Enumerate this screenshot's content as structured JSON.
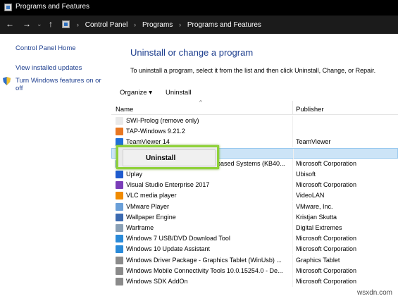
{
  "window": {
    "title": "Programs and Features"
  },
  "address": {
    "back_icon": "←",
    "forward_icon": "→",
    "recent_icon": "⌄",
    "up_icon": "↑",
    "crumbs": [
      "Control Panel",
      "Programs",
      "Programs and Features"
    ],
    "separator": "›"
  },
  "sidebar": {
    "home": "Control Panel Home",
    "updates": "View installed updates",
    "features_line1": "Turn Windows features on or",
    "features_line2": "off"
  },
  "main": {
    "heading": "Uninstall or change a program",
    "description": "To uninstall a program, select it from the list and then click Uninstall, Change, or Repair."
  },
  "toolbar": {
    "organize": "Organize",
    "organize_arrow": "▾",
    "uninstall": "Uninstall"
  },
  "columns": {
    "name": "Name",
    "publisher": "Publisher",
    "sort_arrow": "^"
  },
  "programs": [
    {
      "name": "SWI-Prolog (remove only)",
      "publisher": "",
      "icon": "prolog-icon",
      "color": "#e9e9e9"
    },
    {
      "name": "TAP-Windows 9.21.2",
      "publisher": "",
      "icon": "tap-icon",
      "color": "#e87722"
    },
    {
      "name": "TeamViewer 14",
      "publisher": "TeamViewer",
      "icon": "teamviewer-icon",
      "color": "#1e6fd9"
    },
    {
      "name": "",
      "publisher": "",
      "icon": "program-icon",
      "color": "#dfe8f3"
    },
    {
      "name": "based Systems (KB40...",
      "publisher": "Microsoft Corporation",
      "icon": "program-icon",
      "color": "#3a7fd6"
    },
    {
      "name": "Uplay",
      "publisher": "Ubisoft",
      "icon": "uplay-icon",
      "color": "#1f5bcf"
    },
    {
      "name": "Visual Studio Enterprise 2017",
      "publisher": "Microsoft Corporation",
      "icon": "visual-studio-icon",
      "color": "#7a3db8"
    },
    {
      "name": "VLC media player",
      "publisher": "VideoLAN",
      "icon": "vlc-icon",
      "color": "#f08a00"
    },
    {
      "name": "VMware Player",
      "publisher": "VMware, Inc.",
      "icon": "vmware-icon",
      "color": "#6a9fd8"
    },
    {
      "name": "Wallpaper Engine",
      "publisher": "Kristjan Skutta",
      "icon": "wallpaper-engine-icon",
      "color": "#3c6ab0"
    },
    {
      "name": "Warframe",
      "publisher": "Digital Extremes",
      "icon": "warframe-icon",
      "color": "#8aa0b5"
    },
    {
      "name": "Windows 7 USB/DVD Download Tool",
      "publisher": "Microsoft Corporation",
      "icon": "windows-icon",
      "color": "#2a8ad8"
    },
    {
      "name": "Windows 10 Update Assistant",
      "publisher": "Microsoft Corporation",
      "icon": "windows-icon",
      "color": "#2a8ad8"
    },
    {
      "name": "Windows Driver Package - Graphics Tablet (WinUsb) ...",
      "publisher": "Graphics Tablet",
      "icon": "installer-icon",
      "color": "#8a8a8a"
    },
    {
      "name": "Windows Mobile Connectivity Tools 10.0.15254.0 - De...",
      "publisher": "Microsoft Corporation",
      "icon": "installer-icon",
      "color": "#8a8a8a"
    },
    {
      "name": "Windows SDK AddOn",
      "publisher": "Microsoft Corporation",
      "icon": "installer-icon",
      "color": "#8a8a8a"
    }
  ],
  "context_menu": {
    "uninstall": "Uninstall"
  },
  "colors": {
    "highlight_border": "#8fd13a",
    "selection": "#cce4f7",
    "link": "#1e3f8f"
  },
  "watermark": "wsxdn.com"
}
